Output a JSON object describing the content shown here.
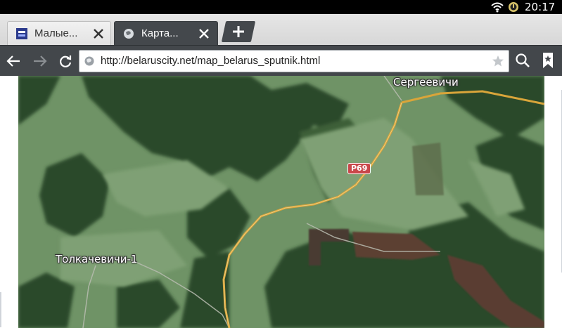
{
  "status_bar": {
    "time": "20:17",
    "icons": [
      "wifi-icon",
      "sync-icon"
    ]
  },
  "tabs": [
    {
      "title": "Малые...",
      "favicon": "page-favicon-icon",
      "active": false
    },
    {
      "title": "Карта...",
      "favicon": "globe-icon",
      "active": true
    }
  ],
  "toolbar": {
    "back_icon": "back-arrow-icon",
    "forward_icon": "forward-arrow-icon",
    "reload_icon": "reload-icon",
    "url": "http://belaruscity.net/map_belarus_sputnik.html",
    "site_icon": "globe-icon",
    "bookmark_star_icon": "star-icon",
    "search_icon": "search-icon",
    "bookmarks_icon": "bookmarks-icon"
  },
  "map": {
    "type": "satellite",
    "places": [
      {
        "name": "Сергеевичи"
      },
      {
        "name": "Толкачевичи-1"
      }
    ],
    "road_label": "Р69",
    "colors": {
      "forest": "#2f4a2f",
      "field": "#6e9466",
      "road": "#d9a53a",
      "road_shield": "#c9474a"
    }
  }
}
